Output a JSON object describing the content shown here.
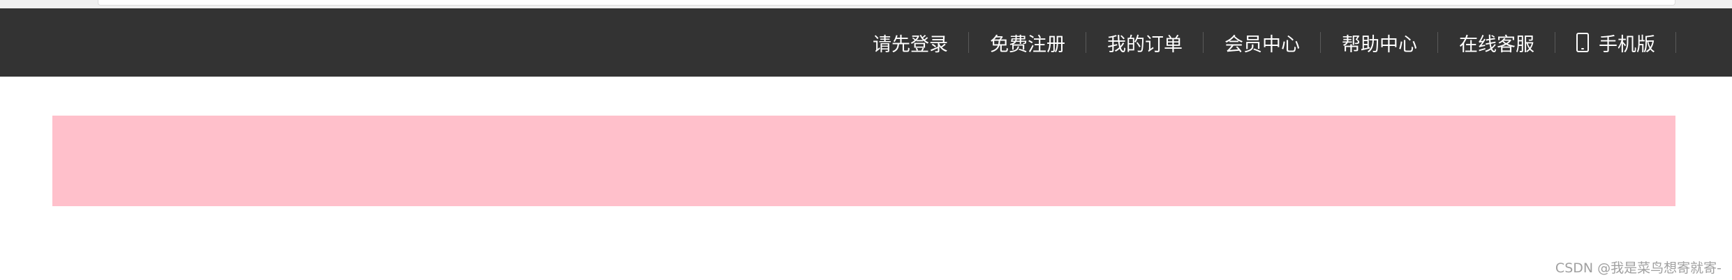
{
  "nav": {
    "items": [
      {
        "label": "请先登录"
      },
      {
        "label": "免费注册"
      },
      {
        "label": "我的订单"
      },
      {
        "label": "会员中心"
      },
      {
        "label": "帮助中心"
      },
      {
        "label": "在线客服"
      },
      {
        "label": "手机版",
        "icon": "mobile-phone-icon"
      }
    ]
  },
  "colors": {
    "navbar_bg": "#333333",
    "nav_text": "#ffffff",
    "banner_bg": "#ffc0cb"
  },
  "watermark": {
    "text": "CSDN @我是菜鸟想寄就寄-"
  }
}
